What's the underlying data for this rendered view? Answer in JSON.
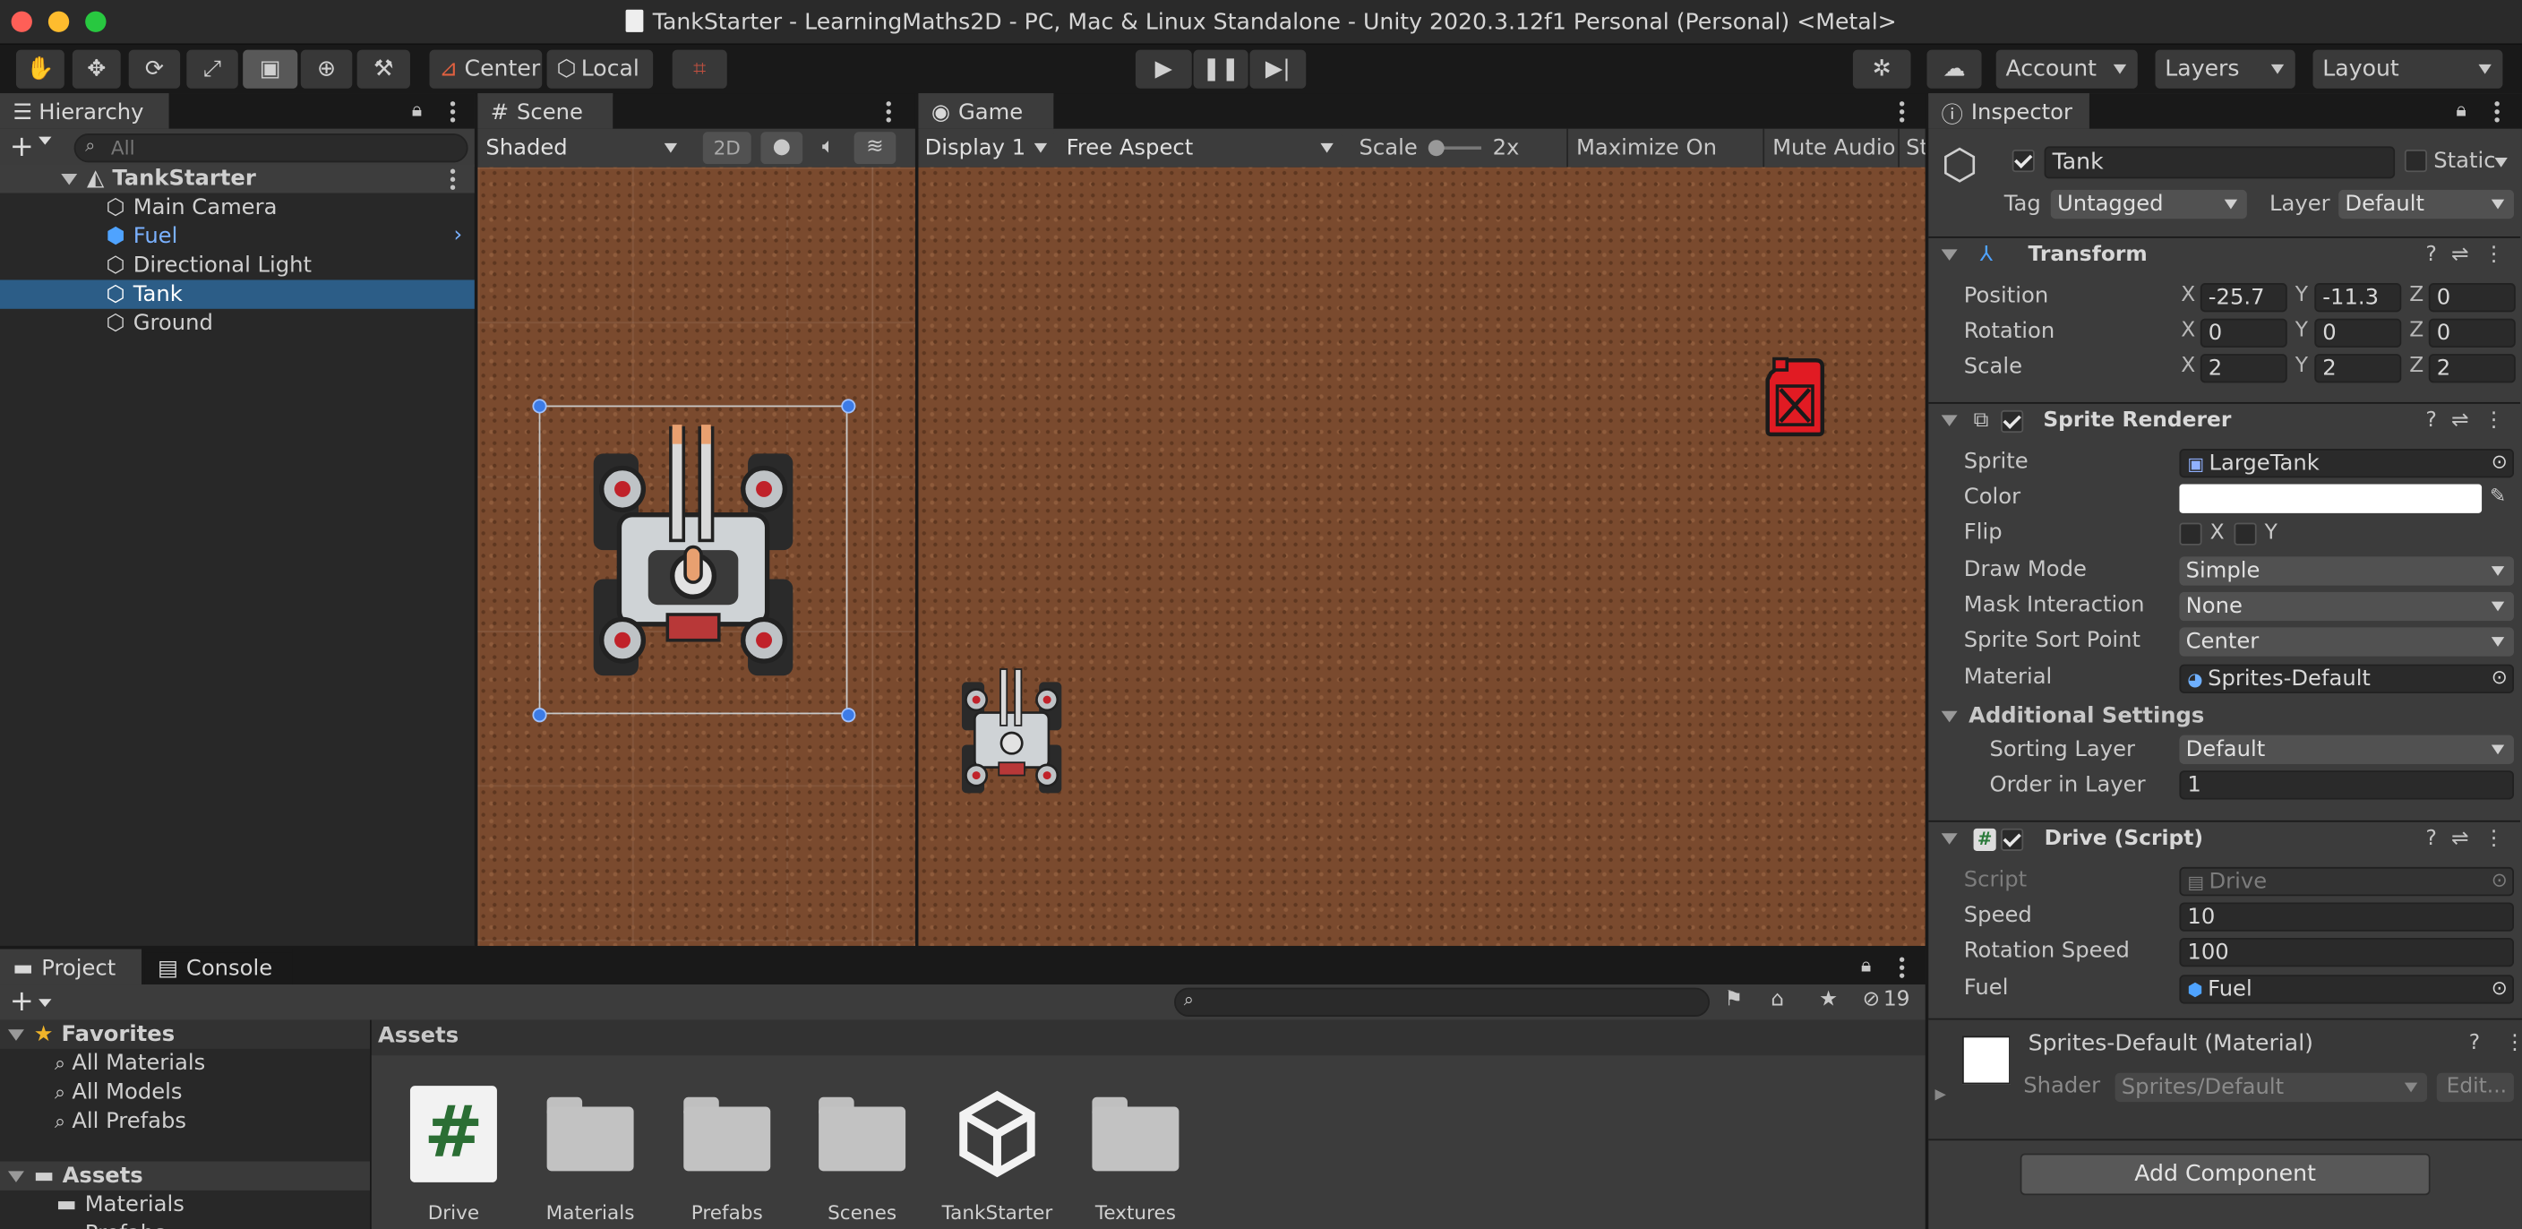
{
  "window": {
    "title": "TankStarter - LearningMaths2D - PC, Mac & Linux Standalone - Unity 2020.3.12f1 Personal (Personal) <Metal>"
  },
  "toolbar": {
    "pivot": "Center",
    "space": "Local",
    "account": "Account",
    "layers": "Layers",
    "layout": "Layout"
  },
  "hierarchy": {
    "tab": "Hierarchy",
    "search_placeholder": "All",
    "scene": "TankStarter",
    "items": [
      {
        "label": "Main Camera"
      },
      {
        "label": "Fuel"
      },
      {
        "label": "Directional Light"
      },
      {
        "label": "Tank"
      },
      {
        "label": "Ground"
      }
    ]
  },
  "scene": {
    "tab": "Scene",
    "shading": "Shaded",
    "mode_2d": "2D"
  },
  "game": {
    "tab": "Game",
    "display": "Display 1",
    "aspect": "Free Aspect",
    "scale_label": "Scale",
    "scale_value": "2x",
    "maximize": "Maximize On Play",
    "mute": "Mute Audio",
    "stats": "St"
  },
  "inspector": {
    "tab": "Inspector",
    "object_name": "Tank",
    "static_label": "Static",
    "tag_label": "Tag",
    "tag_value": "Untagged",
    "layer_label": "Layer",
    "layer_value": "Default",
    "transform": {
      "title": "Transform",
      "position": {
        "label": "Position",
        "x": "-25.7",
        "y": "-11.3",
        "z": "0"
      },
      "rotation": {
        "label": "Rotation",
        "x": "0",
        "y": "0",
        "z": "0"
      },
      "scale": {
        "label": "Scale",
        "x": "2",
        "y": "2",
        "z": "2"
      }
    },
    "sprite_renderer": {
      "title": "Sprite Renderer",
      "sprite_label": "Sprite",
      "sprite_value": "LargeTank",
      "color_label": "Color",
      "color_value": "#ffffff",
      "flip_label": "Flip",
      "flip_x": "X",
      "flip_y": "Y",
      "draw_mode_label": "Draw Mode",
      "draw_mode_value": "Simple",
      "mask_label": "Mask Interaction",
      "mask_value": "None",
      "sort_point_label": "Sprite Sort Point",
      "sort_point_value": "Center",
      "material_label": "Material",
      "material_value": "Sprites-Default",
      "additional": "Additional Settings",
      "sorting_layer_label": "Sorting Layer",
      "sorting_layer_value": "Default",
      "order_label": "Order in Layer",
      "order_value": "1"
    },
    "drive": {
      "title": "Drive (Script)",
      "script_label": "Script",
      "script_value": "Drive",
      "speed_label": "Speed",
      "speed_value": "10",
      "rot_speed_label": "Rotation Speed",
      "rot_speed_value": "100",
      "fuel_label": "Fuel",
      "fuel_value": "Fuel"
    },
    "material": {
      "title": "Sprites-Default (Material)",
      "shader_label": "Shader",
      "shader_value": "Sprites/Default",
      "edit": "Edit..."
    },
    "add_component": "Add Component"
  },
  "project": {
    "tab_project": "Project",
    "tab_console": "Console",
    "hidden_count": "19",
    "favorites": "Favorites",
    "fav_items": [
      {
        "label": "All Materials"
      },
      {
        "label": "All Models"
      },
      {
        "label": "All Prefabs"
      }
    ],
    "assets_root": "Assets",
    "tree_items": [
      {
        "label": "Materials"
      },
      {
        "label": "Prefabs"
      }
    ],
    "breadcrumb": "Assets",
    "assets": [
      {
        "label": "Drive"
      },
      {
        "label": "Materials"
      },
      {
        "label": "Prefabs"
      },
      {
        "label": "Scenes"
      },
      {
        "label": "TankStarter"
      },
      {
        "label": "Textures"
      }
    ]
  },
  "colors": {
    "selection": "#2c5d87",
    "dirt": "#7a4a2e",
    "accent_blue": "#4c8fe6",
    "fuel_red": "#e11b23"
  }
}
